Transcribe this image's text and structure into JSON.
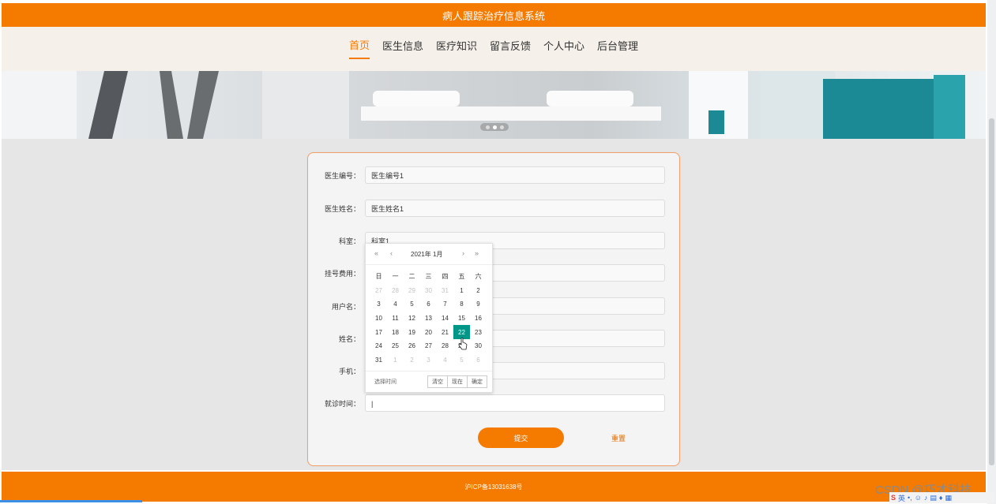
{
  "app": {
    "title": "病人跟踪治疗信息系统"
  },
  "nav": {
    "items": [
      {
        "label": "首页",
        "active": true
      },
      {
        "label": "医生信息"
      },
      {
        "label": "医疗知识"
      },
      {
        "label": "留言反馈"
      },
      {
        "label": "个人中心"
      },
      {
        "label": "后台管理"
      }
    ]
  },
  "form": {
    "fields": [
      {
        "label": "医生编号：",
        "value": "医生编号1"
      },
      {
        "label": "医生姓名：",
        "value": "医生姓名1"
      },
      {
        "label": "科室：",
        "value": "科室1"
      },
      {
        "label": "挂号费用：",
        "value": ""
      },
      {
        "label": "用户名：",
        "value": ""
      },
      {
        "label": "姓名：",
        "value": ""
      },
      {
        "label": "手机：",
        "value": ""
      },
      {
        "label": "就诊时间：",
        "value": "|"
      }
    ],
    "submit_label": "提交",
    "reset_label": "重置"
  },
  "datepicker": {
    "year_month": "2021年  1月",
    "nav_prev_year": "«",
    "nav_prev_month": "‹",
    "nav_next_month": "›",
    "nav_next_year": "»",
    "weekdays": [
      "日",
      "一",
      "二",
      "三",
      "四",
      "五",
      "六"
    ],
    "weeks": [
      [
        "27",
        "28",
        "29",
        "30",
        "31",
        "1",
        "2"
      ],
      [
        "3",
        "4",
        "5",
        "6",
        "7",
        "8",
        "9"
      ],
      [
        "10",
        "11",
        "12",
        "13",
        "14",
        "15",
        "16"
      ],
      [
        "17",
        "18",
        "19",
        "20",
        "21",
        "22",
        "23"
      ],
      [
        "24",
        "25",
        "26",
        "27",
        "28",
        "29",
        "30"
      ],
      [
        "31",
        "1",
        "2",
        "3",
        "4",
        "5",
        "6"
      ]
    ],
    "selected": "22",
    "select_time_label": "选择时间",
    "clear_label": "清空",
    "now_label": "现在",
    "confirm_label": "确定"
  },
  "footer": {
    "text": "沪ICP备13031638号"
  },
  "overlay": {
    "watermark": "CSDN @巧才科技",
    "tray_lang": "英"
  },
  "colors": {
    "accent": "#f57a00",
    "selected": "#009688"
  }
}
